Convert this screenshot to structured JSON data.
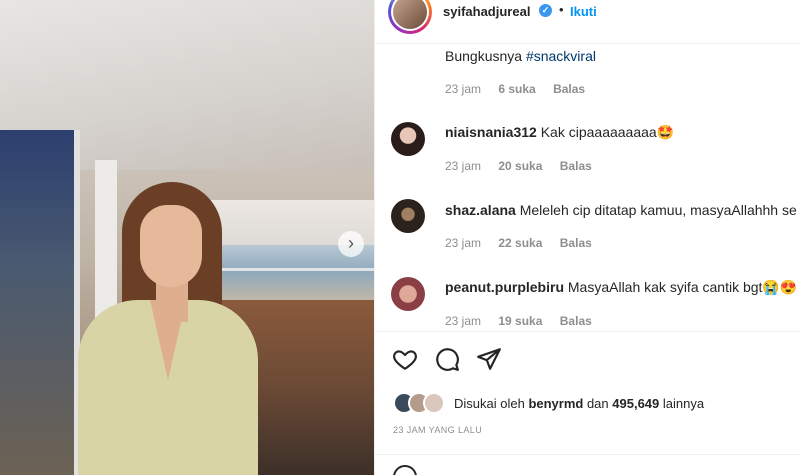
{
  "post": {
    "username": "syifahadjureal",
    "separator": "•",
    "follow_label": "Ikuti",
    "carousel_next_glyph": "›"
  },
  "comments": [
    {
      "text_prefix": "Bungkusnya ",
      "hashtag": "#snackviral",
      "time": "23 jam",
      "likes": "6 suka",
      "reply": "Balas"
    },
    {
      "user": "niaisnania312",
      "text": "Kak cipaaaaaaaaa🤩",
      "time": "23 jam",
      "likes": "20 suka",
      "reply": "Balas"
    },
    {
      "user": "shaz.alana",
      "text": "Meleleh cip ditatap kamuu, masyaAllahhh se",
      "time": "23 jam",
      "likes": "22 suka",
      "reply": "Balas"
    },
    {
      "user": "peanut.purplebiru",
      "text": "MasyaAllah kak syifa cantik bgt😭😍",
      "time": "23 jam",
      "likes": "19 suka",
      "reply": "Balas"
    }
  ],
  "likes": {
    "prefix": "Disukai oleh ",
    "liker": "benyrmd",
    "middle": " dan ",
    "count": "495,649",
    "suffix": " lainnya"
  },
  "time_ago": "23 JAM YANG LALU",
  "icons": [
    "heart-icon",
    "comment-icon",
    "share-icon",
    "verified-icon",
    "emoji-icon"
  ],
  "colors": {
    "accent": "#0095f6",
    "verified": "#3897f0",
    "muted": "#8e8e8e"
  }
}
